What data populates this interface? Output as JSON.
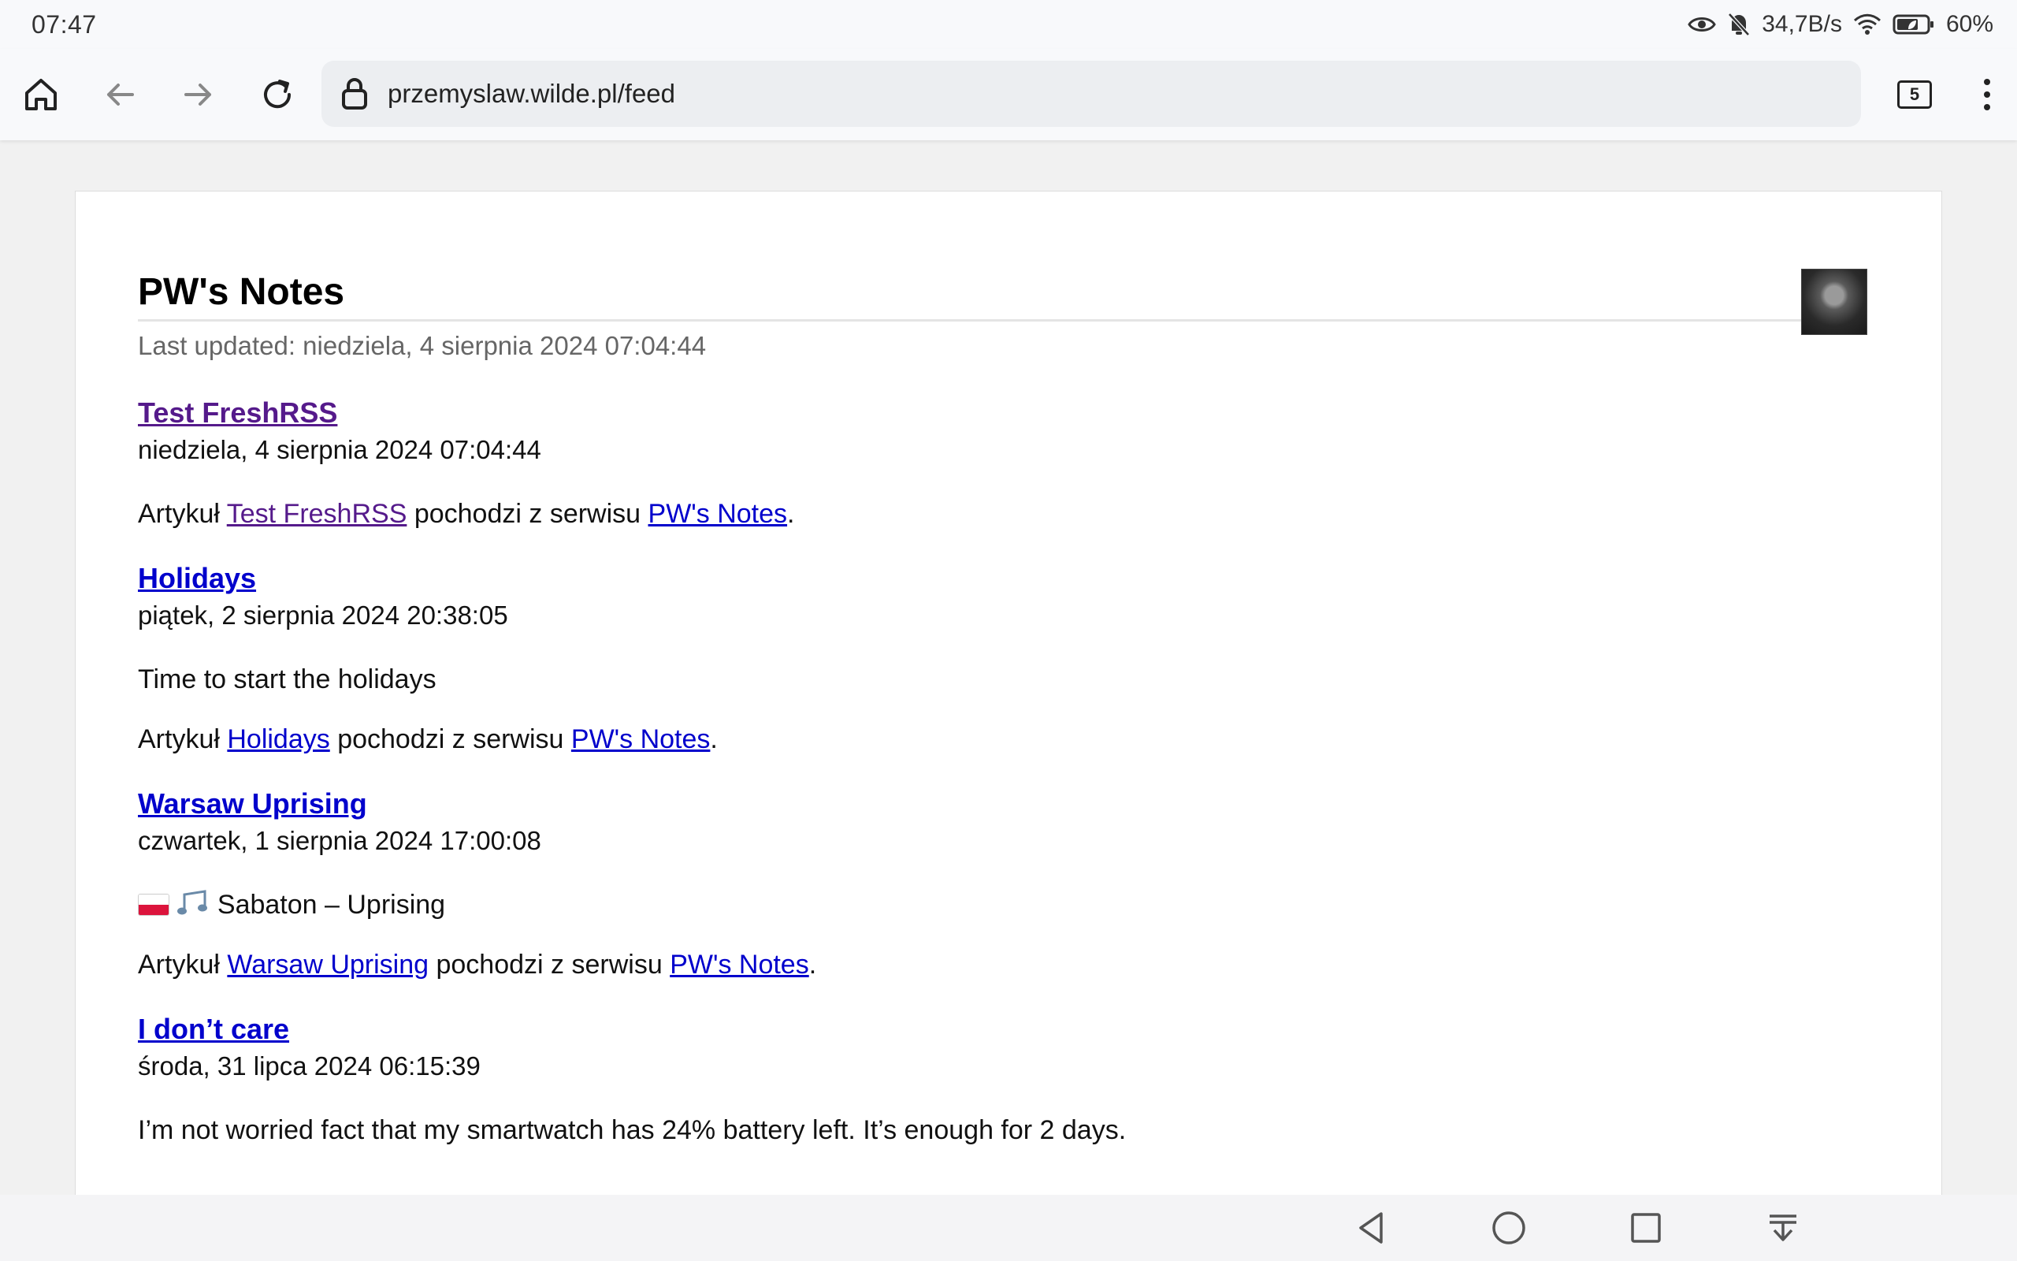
{
  "status_bar": {
    "time": "07:47",
    "network_speed": "34,7B/s",
    "battery": "60%",
    "icons": [
      "eye-icon",
      "bell-off-icon",
      "wifi-icon",
      "battery-icon"
    ]
  },
  "browser": {
    "url": "przemyslaw.wilde.pl/feed",
    "tab_count": "5"
  },
  "feed": {
    "title": "PW's Notes",
    "updated": "Last updated: niedziela, 4 sierpnia 2024 07:04:44",
    "entries": [
      {
        "title": "Test FreshRSS",
        "date": "niedziela, 4 sierpnia 2024 07:04:44",
        "source_prefix": "Artykuł ",
        "source_mid": " pochodzi z serwisu ",
        "source_site": "PW's Notes",
        "source_suffix": "."
      },
      {
        "title": "Holidays",
        "date": "piątek, 2 sierpnia 2024 20:38:05",
        "body": "Time to start the holidays",
        "source_prefix": "Artykuł ",
        "source_mid": " pochodzi z serwisu ",
        "source_site": "PW's Notes",
        "source_suffix": "."
      },
      {
        "title": "Warsaw Uprising",
        "date": "czwartek, 1 sierpnia 2024 17:00:08",
        "body": "Sabaton – Uprising",
        "source_prefix": "Artykuł ",
        "source_mid": " pochodzi z serwisu ",
        "source_site": "PW's Notes",
        "source_suffix": "."
      },
      {
        "title": "I don’t care",
        "date": "środa, 31 lipca 2024 06:15:39",
        "body": "I’m not worried fact that my smartwatch has 24% battery left. It’s enough for 2 days."
      }
    ]
  },
  "colors": {
    "visited_link": "#551a8b",
    "link": "#0000cc",
    "flag_white": "#ffffff",
    "flag_red": "#dc143c"
  }
}
